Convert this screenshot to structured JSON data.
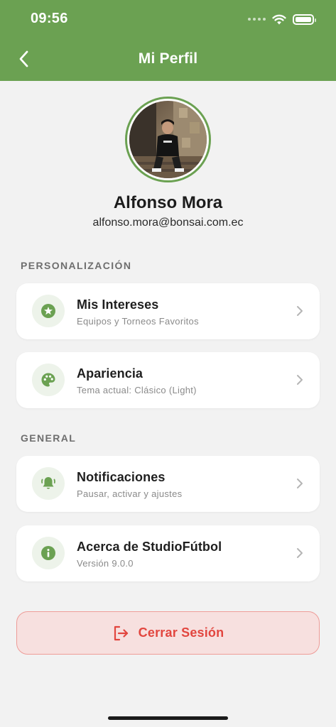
{
  "status_bar": {
    "time": "09:56"
  },
  "header": {
    "title": "Mi Perfil",
    "back_icon": "chevron-left-icon"
  },
  "profile": {
    "name": "Alfonso Mora",
    "email": "alfonso.mora@bonsai.com.ec"
  },
  "sections": {
    "personalization": {
      "label": "PERSONALIZACIÓN",
      "items": [
        {
          "title": "Mis Intereses",
          "subtitle": "Equipos y Torneos Favoritos",
          "icon": "star-icon"
        },
        {
          "title": "Apariencia",
          "subtitle": "Tema actual: Clásico (Light)",
          "icon": "palette-icon"
        }
      ]
    },
    "general": {
      "label": "GENERAL",
      "items": [
        {
          "title": "Notificaciones",
          "subtitle": "Pausar, activar y ajustes",
          "icon": "bell-icon"
        },
        {
          "title": "Acerca de StudioFútbol",
          "subtitle": "Versión 9.0.0",
          "icon": "info-icon"
        }
      ]
    }
  },
  "logout": {
    "label": "Cerrar Sesión",
    "icon": "logout-icon"
  },
  "colors": {
    "accent": "#6ba152",
    "icon_bg": "#edf3ea",
    "danger": "#e2463f",
    "danger_bg": "#f7e0df",
    "page_bg": "#f2f2f2"
  }
}
